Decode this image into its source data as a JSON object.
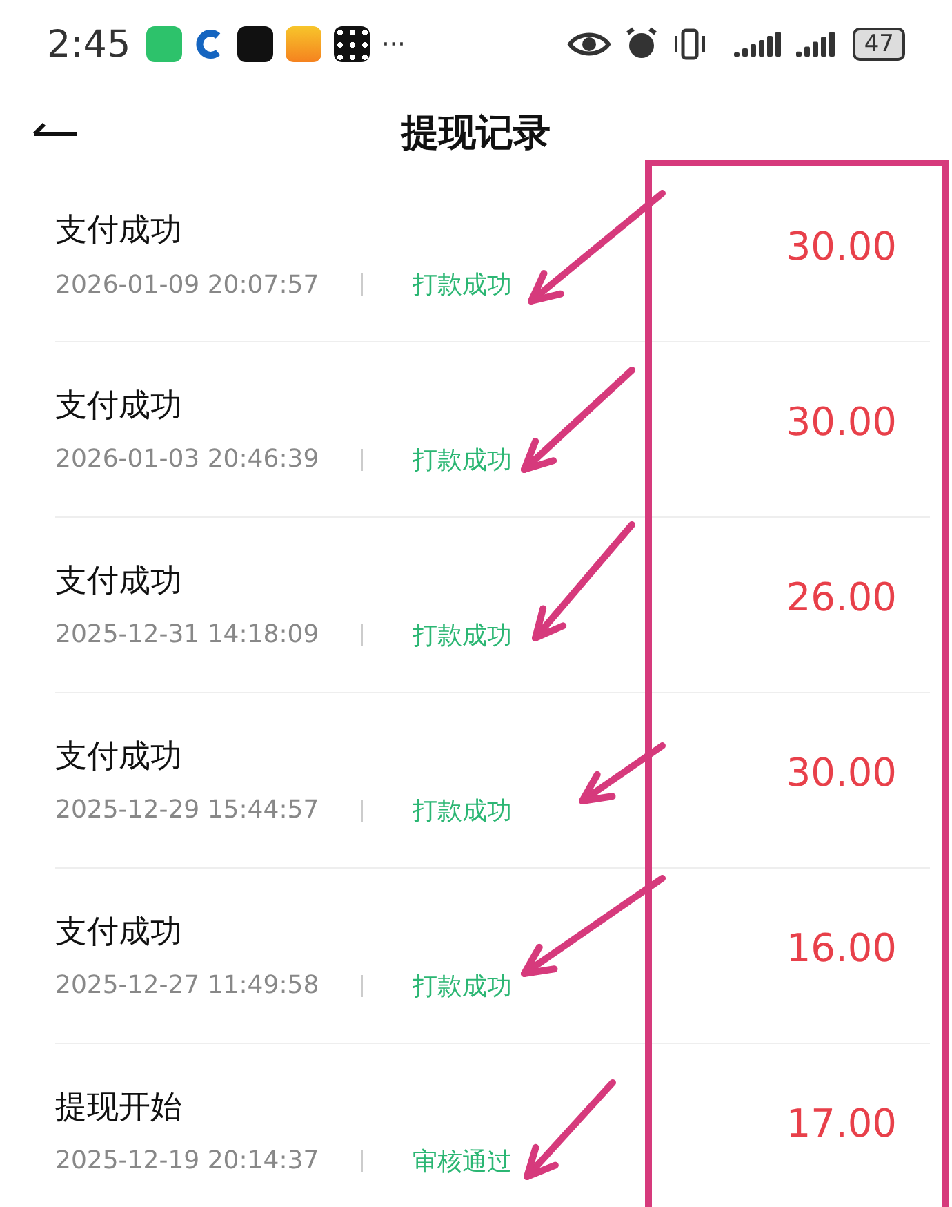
{
  "status_bar": {
    "time": "2:45",
    "more": "···",
    "battery": "47"
  },
  "header": {
    "title": "提现记录"
  },
  "records": [
    {
      "title": "支付成功",
      "time": "2026-01-09 20:07:57",
      "status": "打款成功",
      "amount": "30.00"
    },
    {
      "title": "支付成功",
      "time": "2026-01-03 20:46:39",
      "status": "打款成功",
      "amount": "30.00"
    },
    {
      "title": "支付成功",
      "time": "2025-12-31 14:18:09",
      "status": "打款成功",
      "amount": "26.00"
    },
    {
      "title": "支付成功",
      "time": "2025-12-29 15:44:57",
      "status": "打款成功",
      "amount": "30.00"
    },
    {
      "title": "支付成功",
      "time": "2025-12-27 11:49:58",
      "status": "打款成功",
      "amount": "16.00"
    },
    {
      "title": "提现开始",
      "time": "2025-12-19 20:14:37",
      "status": "审核通过",
      "amount": "17.00"
    }
  ]
}
